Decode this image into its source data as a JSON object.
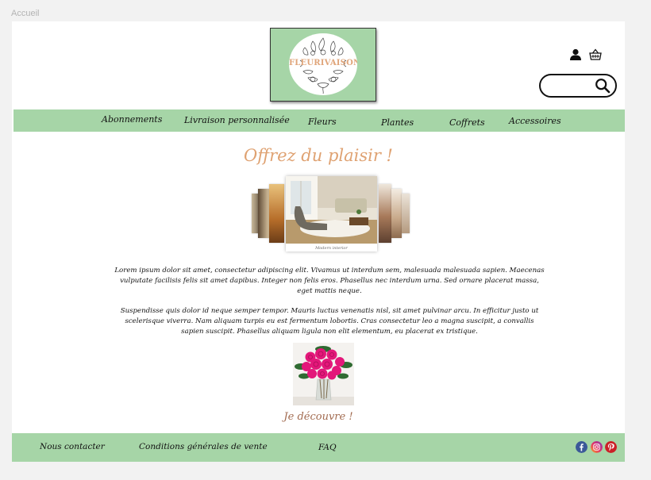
{
  "canvas": {
    "label": "Accueil"
  },
  "header": {
    "logo_text": "FLEURIVAISON",
    "icons": {
      "account": "user-icon",
      "cart": "basket-icon",
      "search": "search-icon"
    },
    "search": {
      "value": "",
      "placeholder": ""
    }
  },
  "nav": {
    "items": [
      {
        "label": "Abonnements"
      },
      {
        "label": "Livraison personnalisée"
      },
      {
        "label": "Fleurs"
      },
      {
        "label": "Plantes"
      },
      {
        "label": "Coffrets"
      },
      {
        "label": "Accessoires"
      }
    ]
  },
  "main": {
    "headline": "Offrez du plaisir !",
    "carousel": {
      "caption": "Modern interior"
    },
    "paragraphs": [
      "Lorem ipsum dolor sit amet, consectetur adipiscing elit. Vivamus ut interdum sem, malesuada malesuada sapien. Maecenas vulputate facilisis felis sit amet dapibus. Integer non felis eros. Phasellus nec interdum urna. Sed ornare placerat massa, eget mattis neque.",
      "Suspendisse quis dolor id neque semper tempor. Mauris luctus venenatis nisl, sit amet pulvinar arcu. In efficitur justo ut scelerisque viverra. Nam aliquam turpis eu est fermentum lobortis. Cras consectetur leo a magna suscipit, a convallis sapien suscipit. Phasellus aliquam ligula non elit elementum, eu placerat ex tristique."
    ],
    "cta": "Je découvre !"
  },
  "footer": {
    "links": [
      {
        "label": "Nous contacter"
      },
      {
        "label": "Conditions générales de vente"
      },
      {
        "label": "FAQ"
      }
    ],
    "social": [
      {
        "name": "facebook-icon",
        "color": "#3b5998"
      },
      {
        "name": "instagram-icon",
        "color": "#c13584"
      },
      {
        "name": "pinterest-icon",
        "color": "#cb2027"
      }
    ]
  },
  "colors": {
    "brand_green": "#a6d5a7",
    "headline_peach": "#dfa272",
    "cta_brown": "#a26b50",
    "logo_peach": "#e0a57a"
  }
}
